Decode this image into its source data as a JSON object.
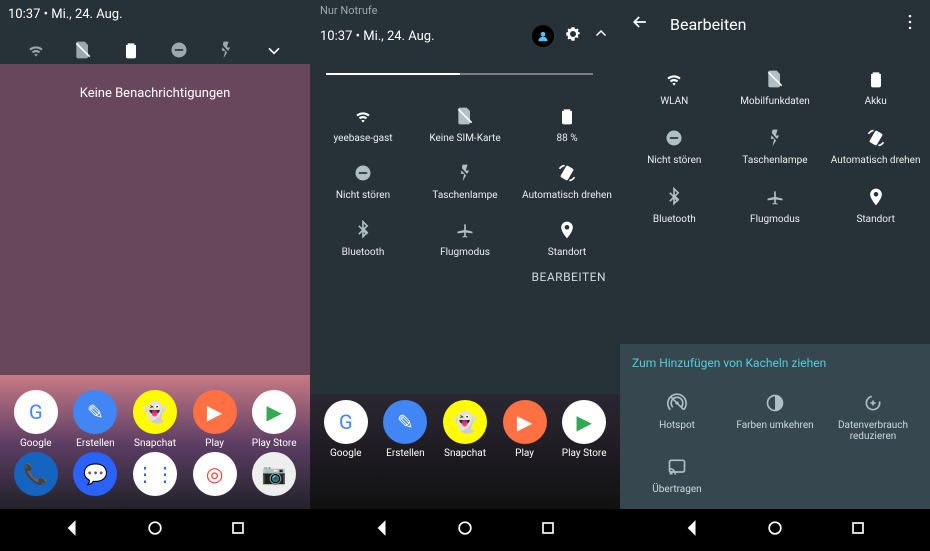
{
  "status_time": "10:37",
  "status_date": "Mi., 24. Aug.",
  "pane1": {
    "no_notifications": "Keine Benachrichtigungen",
    "apps_row1": [
      {
        "label": "Google",
        "bg": "#ffffff",
        "fg": "#4285F4",
        "glyph": "G"
      },
      {
        "label": "Erstellen",
        "bg": "#4285F4",
        "fg": "#ffffff",
        "glyph": "✎"
      },
      {
        "label": "Snapchat",
        "bg": "#FFFC00",
        "fg": "#000000",
        "glyph": "👻"
      },
      {
        "label": "Play",
        "bg": "#ff7043",
        "fg": "#ffffff",
        "glyph": "▶"
      },
      {
        "label": "Play Store",
        "bg": "#ffffff",
        "fg": "#34A853",
        "glyph": "▶"
      }
    ],
    "dock": [
      {
        "bg": "#1565c0",
        "fg": "#ffffff",
        "glyph": "📞"
      },
      {
        "bg": "#2962ff",
        "fg": "#ffffff",
        "glyph": "💬"
      },
      {
        "bg": "#ffffff",
        "fg": "#2962ff",
        "glyph": "⋮⋮"
      },
      {
        "bg": "#ffffff",
        "fg": "#EA4335",
        "glyph": "◎"
      },
      {
        "bg": "#eeeeee",
        "fg": "#4285F4",
        "glyph": "📷"
      }
    ]
  },
  "pane2": {
    "carrier": "Nur Notrufe",
    "edit": "BEARBEITEN",
    "tiles_r1": [
      {
        "label": "yeebase-gast",
        "icon": "wifi",
        "on": true
      },
      {
        "label": "Keine SIM-Karte",
        "icon": "sim",
        "on": false
      },
      {
        "label": "88 %",
        "icon": "battery",
        "on": true
      }
    ],
    "tiles_r2": [
      {
        "label": "Nicht stören",
        "icon": "dnd",
        "on": false
      },
      {
        "label": "Taschenlampe",
        "icon": "flash",
        "on": false
      },
      {
        "label": "Automatisch drehen",
        "icon": "rotate",
        "on": true
      }
    ],
    "tiles_r3": [
      {
        "label": "Bluetooth",
        "icon": "bt",
        "on": false
      },
      {
        "label": "Flugmodus",
        "icon": "plane",
        "on": false
      },
      {
        "label": "Standort",
        "icon": "loc",
        "on": true
      }
    ],
    "apps_row": [
      {
        "label": "Google",
        "bg": "#ffffff",
        "fg": "#4285F4",
        "glyph": "G"
      },
      {
        "label": "Erstellen",
        "bg": "#4285F4",
        "fg": "#ffffff",
        "glyph": "✎"
      },
      {
        "label": "Snapchat",
        "bg": "#FFFC00",
        "fg": "#000000",
        "glyph": "👻"
      },
      {
        "label": "Play",
        "bg": "#ff7043",
        "fg": "#ffffff",
        "glyph": "▶"
      },
      {
        "label": "Play Store",
        "bg": "#ffffff",
        "fg": "#34A853",
        "glyph": "▶"
      }
    ]
  },
  "pane3": {
    "title": "Bearbeiten",
    "tiles": [
      {
        "label": "WLAN",
        "icon": "wifi",
        "on": true
      },
      {
        "label": "Mobilfunkdaten",
        "icon": "sim",
        "on": false
      },
      {
        "label": "Akku",
        "icon": "battery",
        "on": true
      },
      {
        "label": "Nicht stören",
        "icon": "dnd",
        "on": false
      },
      {
        "label": "Taschenlampe",
        "icon": "flash",
        "on": false
      },
      {
        "label": "Automatisch drehen",
        "icon": "rotate",
        "on": true
      },
      {
        "label": "Bluetooth",
        "icon": "bt",
        "on": false
      },
      {
        "label": "Flugmodus",
        "icon": "plane",
        "on": false
      },
      {
        "label": "Standort",
        "icon": "loc",
        "on": true
      }
    ],
    "drag_hint": "Zum Hinzufügen von Kacheln ziehen",
    "extras": [
      {
        "label": "Hotspot",
        "icon": "hotspot"
      },
      {
        "label": "Farben umkehren",
        "icon": "invert"
      },
      {
        "label": "Datenverbrauch reduzieren",
        "icon": "datasav"
      },
      {
        "label": "Übertragen",
        "icon": "cast"
      }
    ]
  }
}
